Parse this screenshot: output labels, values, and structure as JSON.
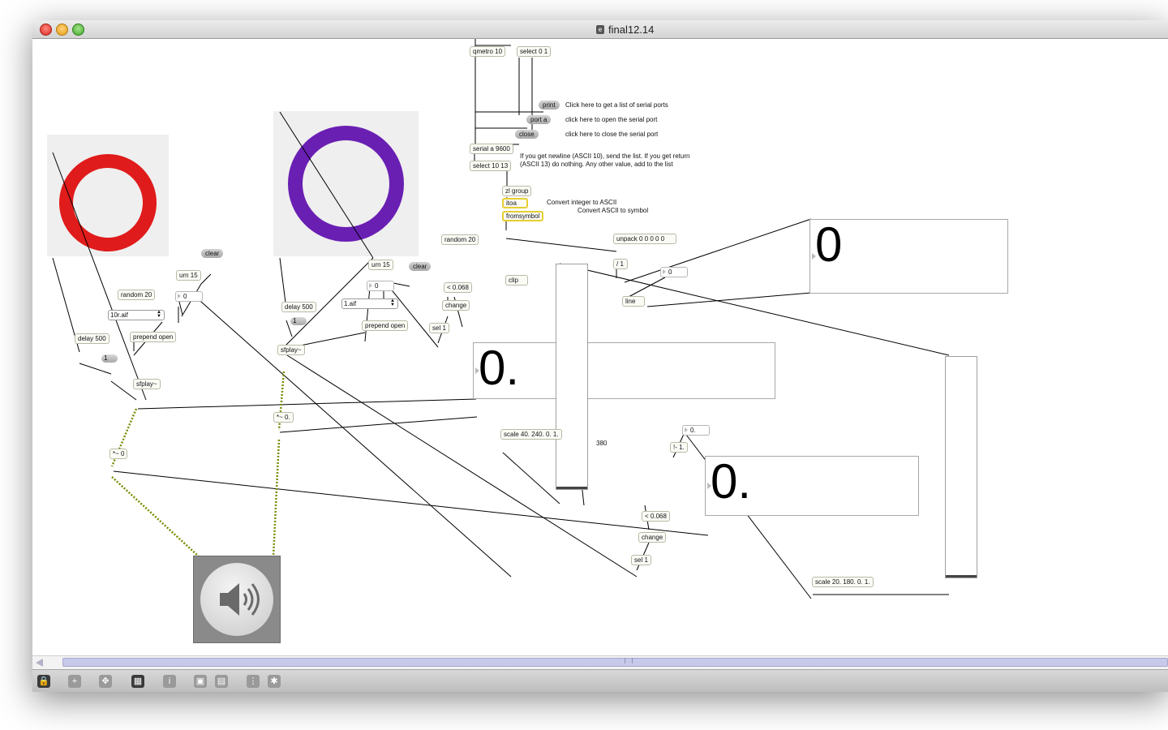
{
  "window": {
    "title": "final12.14"
  },
  "objects": {
    "qmetro": "qmetro 10",
    "select01": "select 0 1",
    "print": "print",
    "port_a": "port a",
    "close": "close",
    "serial": "serial a 9600",
    "select1013": "select 10 13",
    "zl_group": "zl group",
    "itoa": "itoa",
    "fromsymbol": "fromsymbol",
    "random20_top": "random 20",
    "unpack": "unpack 0 0 0 0 0",
    "div1": "/ 1",
    "num_0_right": "0",
    "line": "line",
    "clip": "clip",
    "lt0068_top": "< 0.068",
    "change_top": "change",
    "sel1_top": "sel 1",
    "urn15_mid": "urn 15",
    "clear_mid": "clear",
    "num_0_mid": "0",
    "umenu_mid": "1.aif",
    "prepend_mid": "prepend open",
    "delay500_mid": "delay 500",
    "toggle_mid": "1",
    "sfplay_mid": "sfplay~",
    "mul0_mid": "*~ 0.",
    "clear_left": "clear",
    "urn15_left": "urn 15",
    "num_0_left": "0",
    "random20_left": "random 20",
    "umenu_left": "10r.aif",
    "prepend_left": "prepend open",
    "delay500_left": "delay 500",
    "toggle_left": "1",
    "sfplay_left": "sfplay~",
    "mul0_left": "*~ 0",
    "scale40": "scale 40. 240. 0. 1.",
    "num_0dot_small": "0.",
    "sub1": "!- 1.",
    "lt0068_bot": "< 0.068",
    "change_bot": "change",
    "sel1_bot": "sel 1",
    "scale20": "scale 20. 180. 0. 1."
  },
  "comments": {
    "print_hint": "Click here to get a list of serial ports",
    "open_hint": "click here to open the serial port",
    "close_hint": "click here to close the serial port",
    "newline_hint": "If you get newline (ASCII 10), send the list. If you get return (ASCII 13) do nothing. Any other value, add to the list",
    "itoa_hint": "Convert integer to ASCII",
    "fromsymbol_hint": "Convert ASCII to symbol",
    "value_380": "380"
  },
  "displays": {
    "big_right": "0",
    "big_mid": "0.",
    "big_bot": "0."
  },
  "colors": {
    "ring_red": "#e01b1b",
    "ring_purple": "#6a1fb3",
    "signal_wire": "#7a8a00"
  },
  "toolbar": {
    "items": [
      "lock-icon",
      "plus-icon",
      "move-icon",
      "presentation-icon",
      "info-icon",
      "grid-icon",
      "snap-icon",
      "grid-toggle-icon",
      "fix-icon"
    ]
  }
}
